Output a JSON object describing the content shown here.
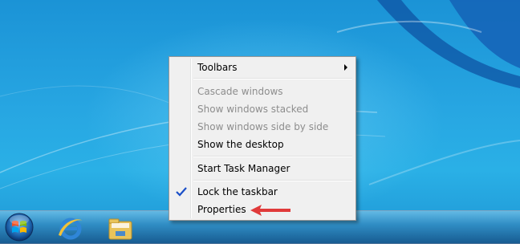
{
  "context_menu": {
    "items": [
      {
        "label": "Toolbars",
        "enabled": true,
        "has_submenu": true
      },
      {
        "label": "Cascade windows",
        "enabled": false
      },
      {
        "label": "Show windows stacked",
        "enabled": false
      },
      {
        "label": "Show windows side by side",
        "enabled": false
      },
      {
        "label": "Show the desktop",
        "enabled": true
      },
      {
        "label": "Start Task Manager",
        "enabled": true
      },
      {
        "label": "Lock the taskbar",
        "enabled": true,
        "checked": true
      },
      {
        "label": "Properties",
        "enabled": true
      }
    ]
  },
  "taskbar": {
    "pinned": [
      {
        "icon": "windows-start-orb-icon"
      },
      {
        "icon": "internet-explorer-icon"
      },
      {
        "icon": "windows-explorer-folder-icon"
      }
    ]
  },
  "annotation": {
    "icon": "red-arrow-icon",
    "color": "#e03a3a"
  },
  "colors": {
    "menu_bg": "#f0f0f0",
    "disabled_text": "#8d8d8d",
    "check": "#1a4fc8"
  }
}
